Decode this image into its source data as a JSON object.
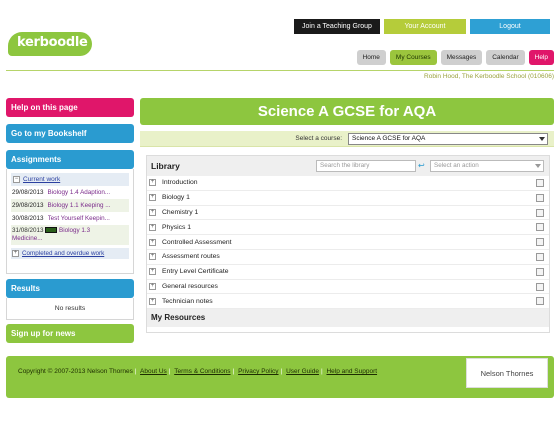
{
  "header": {
    "logo_text": "kerboodle",
    "top_buttons": {
      "join": "Join a Teaching Group",
      "account": "Your Account",
      "logout": "Logout"
    },
    "nav": [
      "Home",
      "My Courses",
      "Messages",
      "Calendar",
      "Help"
    ],
    "user_line": "Robin Hood, The Kerboodle School (010606)"
  },
  "sidebar": {
    "help": "Help on this page",
    "bookshelf": "Go to my Bookshelf",
    "assignments": {
      "title": "Assignments",
      "current_work": "Current work",
      "items": [
        {
          "date": "29/08/2013",
          "title": "Biology 1.4 Adaption..."
        },
        {
          "date": "29/08/2013",
          "title": "Biology 1.1 Keeping ..."
        },
        {
          "date": "30/08/2013",
          "title": "Test Yourself Keepin..."
        },
        {
          "date": "31/08/2013",
          "title": "Biology 1.3",
          "title_line2": "Medicine..."
        }
      ],
      "completed": "Completed and overdue work"
    },
    "results": {
      "title": "Results",
      "empty": "No results"
    },
    "signup": "Sign up for news"
  },
  "main": {
    "title": "Science A GCSE for AQA",
    "course_label": "Select a course:",
    "course_value": "Science A GCSE for AQA",
    "library": {
      "title": "Library",
      "search_placeholder": "Search the library",
      "action_placeholder": "Select an action",
      "items": [
        "Introduction",
        "Biology 1",
        "Chemistry 1",
        "Physics 1",
        "Controlled Assessment",
        "Assessment routes",
        "Entry Level Certificate",
        "General resources",
        "Technician notes"
      ],
      "my_resources": "My Resources"
    }
  },
  "footer": {
    "copyright": "Copyright © 2007-2013 Nelson Thornes",
    "links": [
      "About Us",
      "Terms & Conditions",
      "Privacy Policy",
      "User Guide",
      "Help and Support"
    ],
    "publisher": "Nelson Thornes"
  },
  "colors": {
    "brand_green": "#8dc63f",
    "pink": "#e0166a",
    "blue": "#2a9bd0",
    "black": "#1a1a1a"
  }
}
